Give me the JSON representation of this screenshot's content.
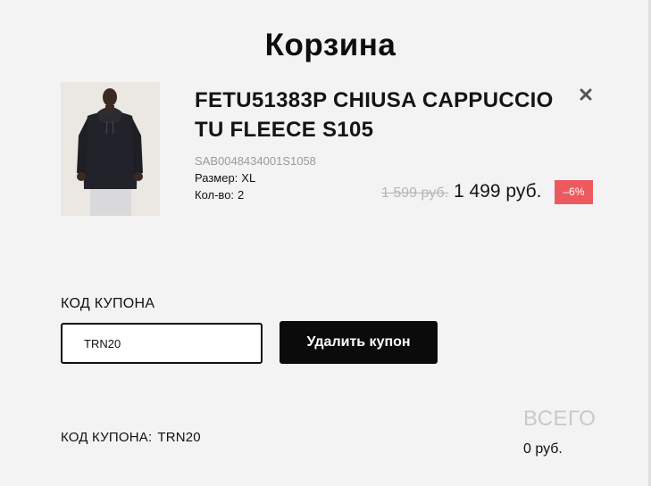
{
  "page": {
    "title": "Корзина"
  },
  "cart_item": {
    "name": "FETU51383P CHIUSA CAPPUCCIO TU FLEECE S105",
    "sku": "SAB0048434001S1058",
    "size_label": "Размер:",
    "size_value": "XL",
    "qty_label": "Кол-во:",
    "qty_value": "2",
    "old_price": "1 599 руб.",
    "new_price": "1 499 руб.",
    "discount": "–6%",
    "remove_icon": "close-x-icon",
    "image": "product-photo-man-black-hoodie"
  },
  "coupon": {
    "heading": "КОД КУПОНА",
    "input_value": "TRN20",
    "button_label": "Удалить купон",
    "applied_label": "КОД КУПОНА:",
    "applied_code": "TRN20"
  },
  "summary": {
    "total_label": "ВСЕГО",
    "total_value": "0 руб."
  },
  "colors": {
    "background": "#f4f3f3",
    "discount_badge": "#ec5a5f",
    "button": "#0b0b0b",
    "muted_text": "#9a9a9a"
  }
}
